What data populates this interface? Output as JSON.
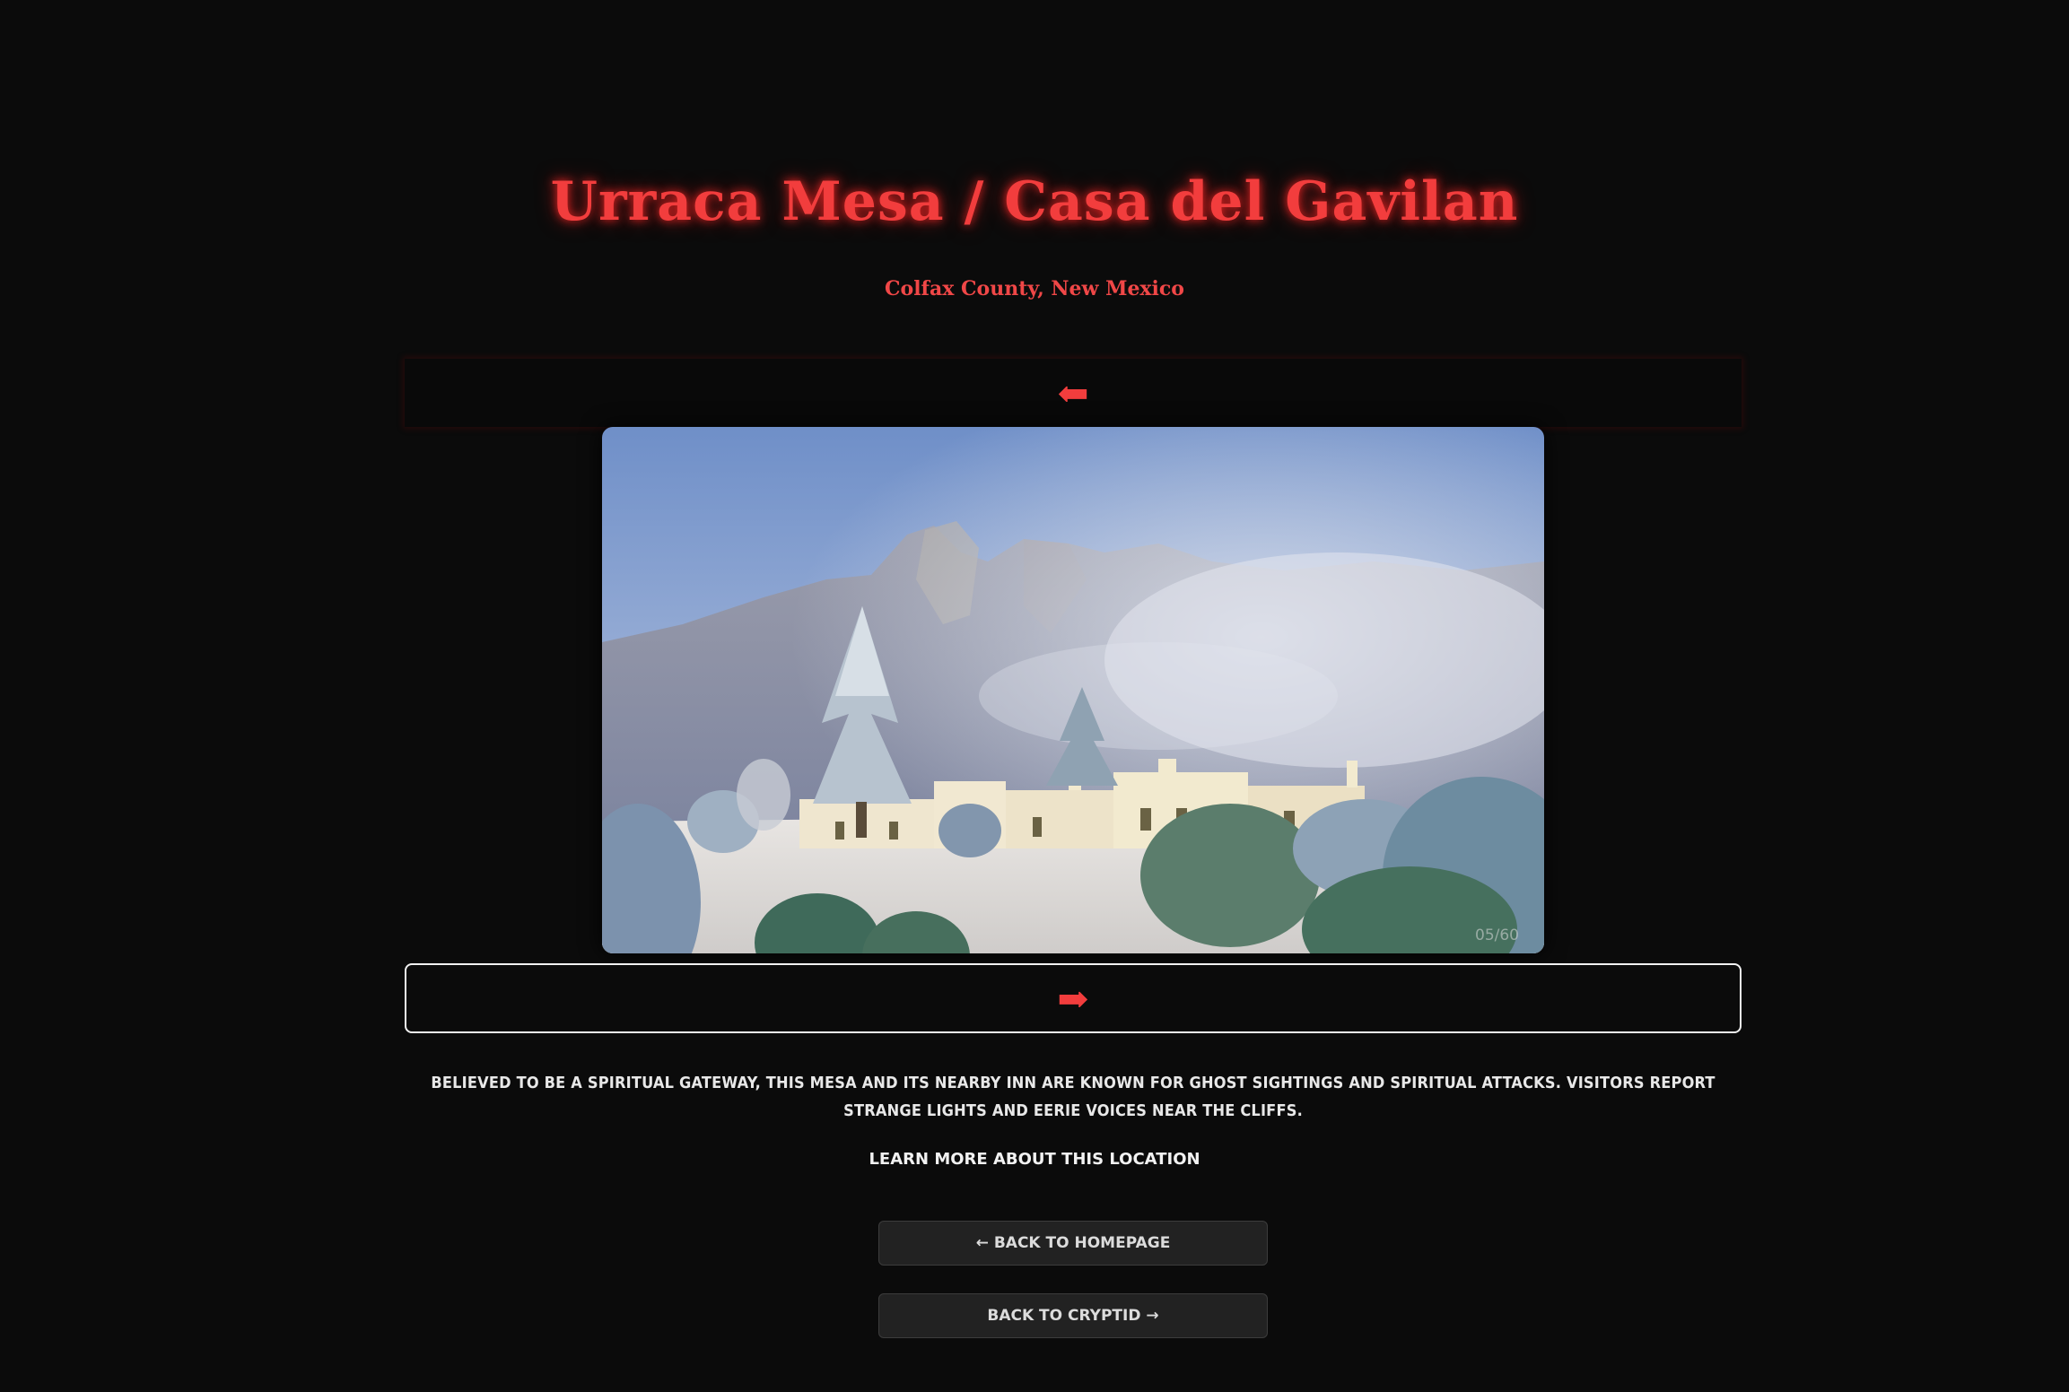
{
  "header": {
    "title": "Urraca Mesa / Casa del Gavilan",
    "subtitle": "Colfax County, New Mexico"
  },
  "gallery": {
    "prev_arrow": "⬅",
    "next_arrow": "➡",
    "counter": "05/60"
  },
  "content": {
    "description": "Believed to be a spiritual gateway, this mesa and its nearby inn are known for ghost sightings and spiritual attacks. Visitors report strange lights and eerie voices near the cliffs.",
    "learn_more": "Learn more about this location"
  },
  "nav": {
    "back_home": "← Back to Homepage",
    "back_cryptid": "Back to Cryptid →"
  },
  "colors": {
    "background": "#0b0b0b",
    "accent_red": "#f23d3d",
    "text_light": "#e8e8e8",
    "button_bg": "#222222"
  }
}
